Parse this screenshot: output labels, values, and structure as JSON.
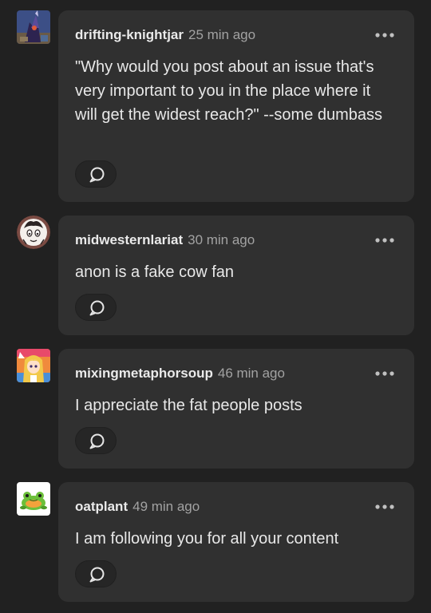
{
  "comments": [
    {
      "username": "drifting-knightjar",
      "timestamp": "25 min ago",
      "text": "\"Why would you post about an issue that's very important to you in the place where it will get the widest reach?\" --some dumbass",
      "avatar_icon": "knight-avatar-icon",
      "more_icon": "ellipsis-icon",
      "reply_icon": "speech-bubble-icon"
    },
    {
      "username": "midwesternlariat",
      "timestamp": "30 min ago",
      "text": "anon is a fake cow fan",
      "avatar_icon": "drawn-character-avatar-icon",
      "more_icon": "ellipsis-icon",
      "reply_icon": "speech-bubble-icon"
    },
    {
      "username": "mixingmetaphorsoup",
      "timestamp": "46 min ago",
      "text": "I appreciate the fat people posts",
      "avatar_icon": "anime-character-avatar-icon",
      "more_icon": "ellipsis-icon",
      "reply_icon": "speech-bubble-icon"
    },
    {
      "username": "oatplant",
      "timestamp": "49 min ago",
      "text": "I am following you for all your content",
      "avatar_icon": "frog-avatar-icon",
      "more_icon": "ellipsis-icon",
      "reply_icon": "speech-bubble-icon"
    }
  ],
  "colors": {
    "background": "#212121",
    "card": "#303030",
    "username": "#eaeaea",
    "timestamp": "#a2a2a2",
    "body_text": "#e8e8e8"
  }
}
